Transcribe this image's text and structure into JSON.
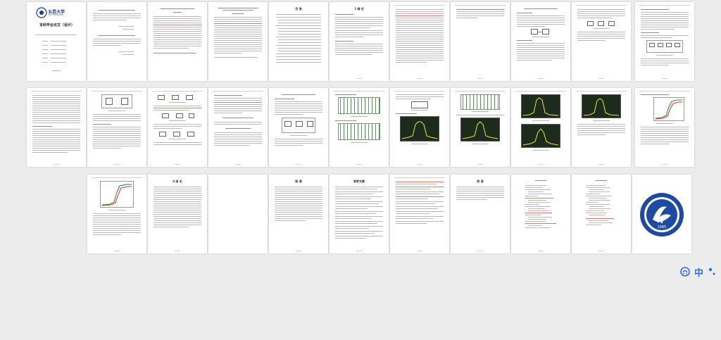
{
  "document": {
    "pages_total": 34,
    "columns": 11,
    "cover": {
      "university": "五邑大学",
      "university_en": "WUYI UNIVERSITY",
      "title": "本科毕业论文（设计）"
    },
    "toc_heading": "目 录",
    "intro_heading": "1 绪 论",
    "chapter4_heading": "4 结 论",
    "refs_heading": "参考文献",
    "thanks_heading": "致 谢",
    "appendix_heading": "附 录",
    "seal_year": "1985"
  },
  "ime": {
    "input_icon": "input-method-icon",
    "mode_label": "中",
    "settings_icon": "dot-settings-icon"
  }
}
